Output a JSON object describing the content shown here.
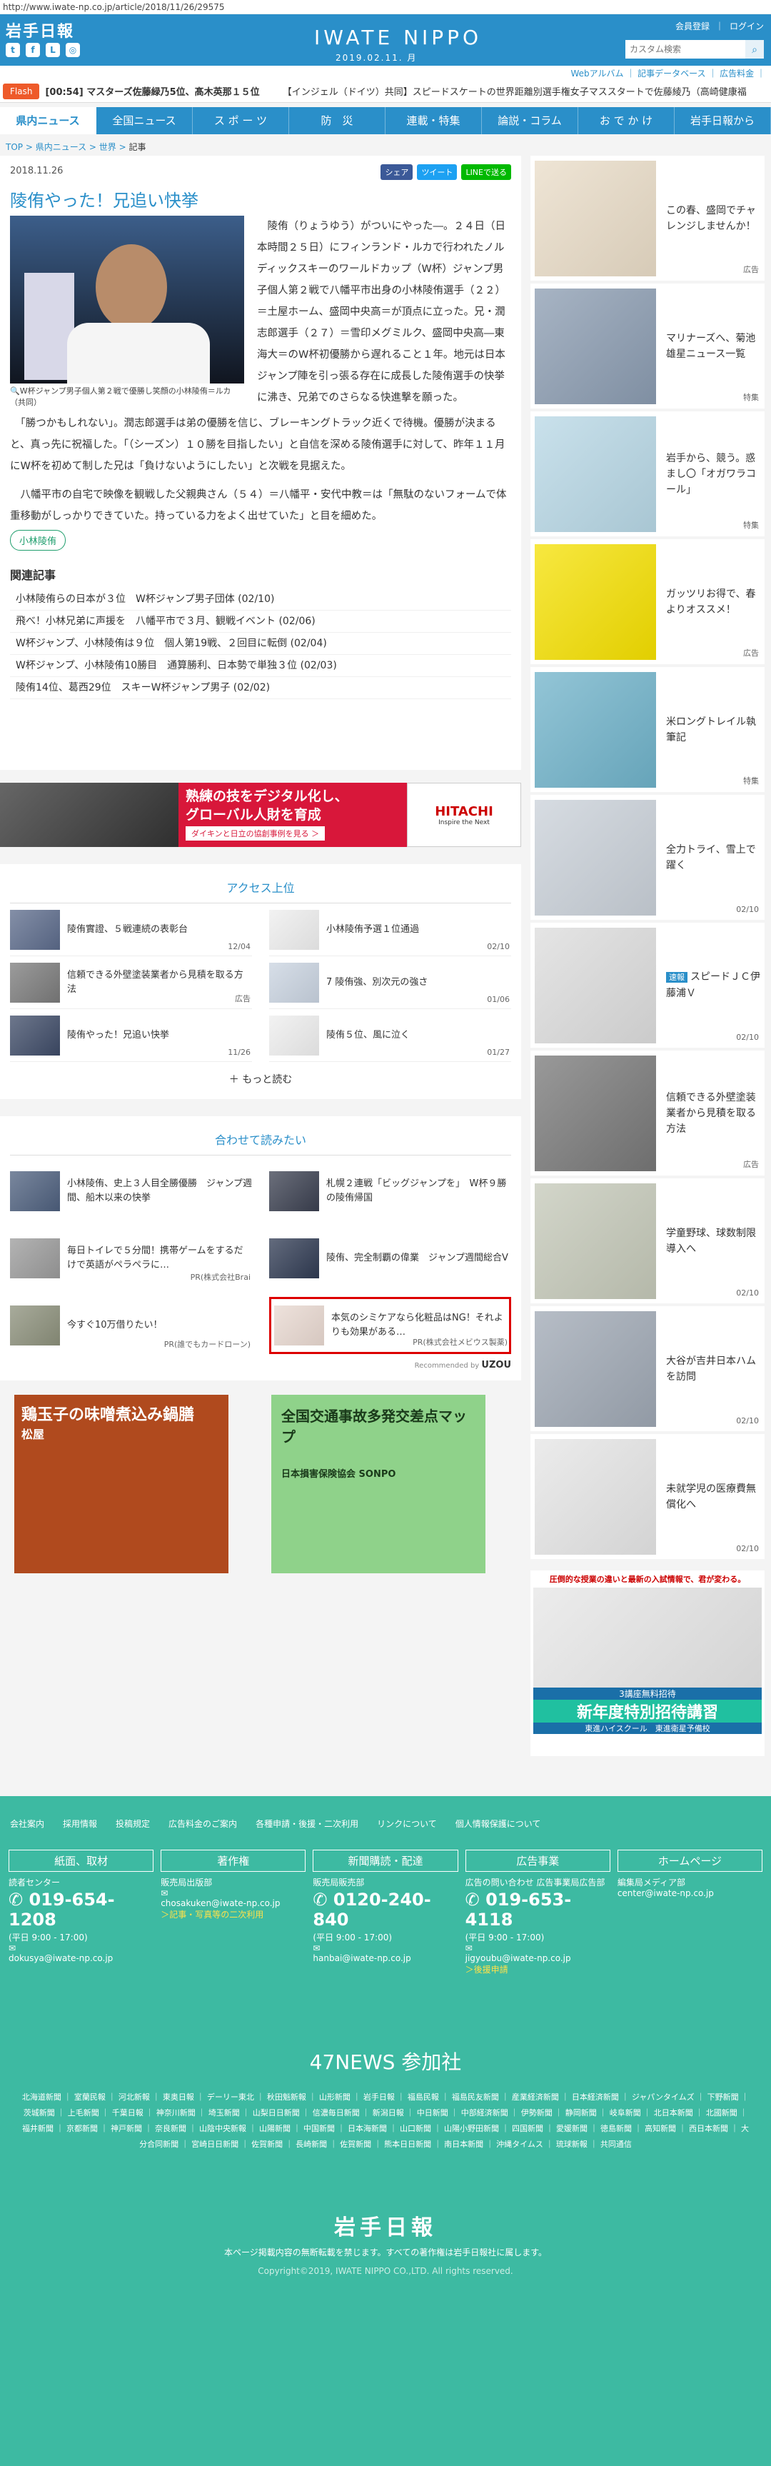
{
  "url": "http://www.iwate-np.co.jp/article/2018/11/26/29575",
  "header": {
    "logo": "岩手日報",
    "brand": "IWATE NIPPO",
    "date": "2019.02.11. 月",
    "member": "会員登録",
    "login": "ログイン",
    "search_placeholder": "カスタム検索",
    "search_brand": "Google",
    "sublinks": "Webアルバム ｜ 記事データベース ｜ 広告料金 ｜"
  },
  "flash": {
    "label": "Flash",
    "items": [
      "[00:54] マスターズ佐藤緑乃5位、髙木英那１５位",
      "【インジェル（ドイツ）共同】スピードスケートの世界距離別選手権女子マススタートで佐藤綾乃（高崎健康福"
    ]
  },
  "nav": [
    "県内ニュース",
    "全国ニュース",
    "ス ポ ー ツ",
    "防　災",
    "連載・特集",
    "論説・コラム",
    "お で か け",
    "岩手日報から"
  ],
  "breadcrumb": [
    "TOP",
    "県内ニュース",
    "世界",
    "記事"
  ],
  "article": {
    "date": "2018.11.26",
    "title": "陵侑やった！兄追い快挙",
    "share": [
      "シェア",
      "ツイート",
      "LINEで送る"
    ],
    "caption": "W杯ジャンプ男子個人第２戦で優勝し笑顔の小林陵侑＝ルカ（共同）",
    "p1": "　陵侑（りょうゆう）がついにやった―。２４日（日本時間２５日）にフィンランド・ルカで行われたノルディックスキーのワールドカップ（W杯）ジャンプ男子個人第２戦で八幡平市出身の小林陵侑選手（２２）＝土屋ホーム、盛岡中央高＝が頂点に立った。兄・潤志郎選手（２７）＝雪印メグミルク、盛岡中央高―東海大＝のW杯初優勝から遅れること１年。地元は日本ジャンプ陣を引っ張る存在に成長した陵侑選手の快挙に沸き、兄弟でのさらなる快進撃を願った。",
    "p2": "　「勝つかもしれない」。潤志郎選手は弟の優勝を信じ、ブレーキングトラック近くで待機。優勝が決まると、真っ先に祝福した。「（シーズン）１０勝を目指したい」と自信を深める陵侑選手に対して、昨年１１月にW杯を初めて制した兄は「負けないようにしたい」と次戦を見据えた。",
    "p3": "　八幡平市の自宅で映像を観戦した父親典さん（５４）＝八幡平・安代中教＝は「無駄のないフォームで体重移動がしっかりできていた。持っている力をよく出せていた」と目を細めた。",
    "tag": "小林陵侑",
    "related_title": "関連記事",
    "related": [
      "小林陵侑らの日本が３位　W杯ジャンプ男子団体 (02/10)",
      "飛べ！小林兄弟に声援を　八幡平市で３月、観戦イベント (02/06)",
      "W杯ジャンプ、小林陵侑は９位　個人第19戦、２回目に転倒 (02/04)",
      "W杯ジャンプ、小林陵侑10勝目　通算勝利、日本勢で単独３位 (02/03)",
      "陵侑14位、葛西29位　スキーW杯ジャンプ男子 (02/02)"
    ]
  },
  "banner": {
    "line1": "熟練の技をデジタル化し、",
    "line2": "グローバル人財を育成",
    "cta": "ダイキンと日立の協創事例を見る ＞",
    "brand": "HITACHI",
    "tagline": "Inspire the Next"
  },
  "ranking": {
    "title": "アクセス上位",
    "items": [
      {
        "t": "陵侑實證、５戦連続の表彰台",
        "d": "12/04"
      },
      {
        "t": "小林陵侑予選１位通過",
        "d": "02/10"
      },
      {
        "t": "信頼できる外壁塗装業者から見積を取る方法",
        "d": "広告"
      },
      {
        "t": "7 陵侑強、別次元の強さ",
        "d": "01/06"
      },
      {
        "t": "陵侑やった！兄追い快挙",
        "d": "11/26"
      },
      {
        "t": "陵侑５位、風に泣く",
        "d": "01/27"
      }
    ],
    "more": "もっと読む"
  },
  "recommend": {
    "title": "合わせて読みたい",
    "items": [
      {
        "t": "小林陵侑、史上３人目全勝優勝　ジャンプ週間、船木以来の快挙",
        "d": ""
      },
      {
        "t": "札幌２連戦「ビッグジャンプを」　W杯９勝の陵侑帰国",
        "d": ""
      },
      {
        "t": "毎日トイレで５分間！携帯ゲームをするだけで英語がペラペラに…",
        "d": "PR(株式会社Brai"
      },
      {
        "t": "陵侑、完全制覇の偉業　ジャンプ週間総合V",
        "d": ""
      },
      {
        "t": "今すぐ10万借りたい！",
        "d": "PR(誰でもカードローン)"
      },
      {
        "t": "本気のシミケアなら化粧品はNG！それよりも効果がある…",
        "d": "PR(株式会社メビウス製薬)"
      }
    ],
    "credit": "Recommended by",
    "credit_brand": "UZOU"
  },
  "ads": {
    "left": "鶏玉子の味噌煮込み鍋膳",
    "left_brand": "松屋",
    "right": "全国交通事故多発交差点マップ",
    "right_brand": "日本損害保険協会 SONPO"
  },
  "sidebar": [
    {
      "t": "この春、盛岡でチャレンジしませんか！",
      "d": "広告"
    },
    {
      "t": "マリナーズへ、菊池雄星ニュース一覧",
      "d": "特集"
    },
    {
      "t": "岩手から、競う。惑まし〇「オガワラコール」",
      "d": "特集"
    },
    {
      "t": "ガッツリお得で、春よりオススメ！",
      "d": "広告"
    },
    {
      "t": "米ロングトレイル執筆記",
      "d": "特集"
    },
    {
      "t": "全力トライ、雪上で躍く",
      "d": "02/10"
    },
    {
      "t": "スピードＪＣ伊藤浦Ｖ",
      "d": "02/10",
      "badge": "速報"
    },
    {
      "t": "信頼できる外壁塗装業者から見積を取る方法",
      "d": "広告"
    },
    {
      "t": "学童野球、球数制限導入へ",
      "d": "02/10"
    },
    {
      "t": "大谷が吉井日本ハムを訪問",
      "d": "02/10"
    },
    {
      "t": "未就学児の医療費無償化へ",
      "d": "02/10"
    }
  ],
  "side_ad": {
    "top": "圧倒的な授業の違いと最新の入試情報で、君が変わる。",
    "mid": "3講座無料招待",
    "big": "新年度特別招待講習",
    "bottom": "東進ハイスクール　東進衛星予備校"
  },
  "footer": {
    "links": [
      "会社案内",
      "採用情報",
      "投稿規定",
      "広告料金のご案内",
      "各種申請・後援・二次利用",
      "リンクについて",
      "個人情報保護について"
    ],
    "cols": [
      {
        "h": "紙面、取材",
        "sub": "読者センター",
        "tel": "019-654-1208",
        "hours": "(平日 9:00 - 17:00)",
        "mail": "dokusya@iwate-np.co.jp",
        "extra": ""
      },
      {
        "h": "著作権",
        "sub": "販売局出版部",
        "tel": "",
        "hours": "",
        "mail": "chosakuken@iwate-np.co.jp",
        "extra": "＞記事・写真等の二次利用"
      },
      {
        "h": "新聞購読・配達",
        "sub": "販売局販売部",
        "tel": "0120-240-840",
        "hours": "(平日 9:00 - 17:00)",
        "mail": "hanbai@iwate-np.co.jp",
        "extra": ""
      },
      {
        "h": "広告事業",
        "sub": "広告の問い合わせ 広告事業局広告部",
        "tel": "019-653-4118",
        "hours": "(平日 9:00 - 17:00)",
        "mail": "jigyoubu@iwate-np.co.jp",
        "extra": "＞後援申請"
      },
      {
        "h": "ホームページ",
        "sub": "編集局メディア部",
        "tel": "",
        "hours": "",
        "mail": "center@iwate-np.co.jp",
        "extra": ""
      }
    ],
    "n47": "47NEWS 参加社",
    "papers": "北海道新聞 ｜ 室蘭民報 ｜ 河北新報 ｜ 東奥日報 ｜ デーリー東北 ｜ 秋田魁新報 ｜ 山形新聞 ｜ 岩手日報 ｜ 福島民報 ｜ 福島民友新聞 ｜ 産業経済新聞 ｜ 日本経済新聞 ｜ ジャパンタイムズ ｜ 下野新聞 ｜ 茨城新聞 ｜ 上毛新聞 ｜ 千葉日報 ｜ 神奈川新聞 ｜ 埼玉新聞 ｜ 山梨日日新聞 ｜ 信濃毎日新聞 ｜ 新潟日報 ｜ 中日新聞 ｜ 中部経済新聞 ｜ 伊勢新聞 ｜ 静岡新聞 ｜ 岐阜新聞 ｜ 北日本新聞 ｜ 北國新聞 ｜ 福井新聞 ｜ 京都新聞 ｜ 神戸新聞 ｜ 奈良新聞 ｜ 山陰中央新報 ｜ 山陽新聞 ｜ 中国新聞 ｜ 日本海新聞 ｜ 山口新聞 ｜ 山陽小野田新聞 ｜ 四国新聞 ｜ 愛媛新聞 ｜ 徳島新聞 ｜ 高知新聞 ｜ 西日本新聞 ｜ 大分合同新聞 ｜ 宮崎日日新聞 ｜ 佐賀新聞 ｜ 長崎新聞 ｜ 佐賀新聞 ｜ 熊本日日新聞 ｜ 南日本新聞 ｜ 沖縄タイムス ｜ 琉球新報 ｜ 共同通信",
    "logo": "岩手日報",
    "note": "本ページ掲載内容の無断転載を禁じます。すべての著作権は岩手日報社に属します。",
    "copy": "Copyright©2019, IWATE NIPPO CO.,LTD. All rights reserved."
  }
}
